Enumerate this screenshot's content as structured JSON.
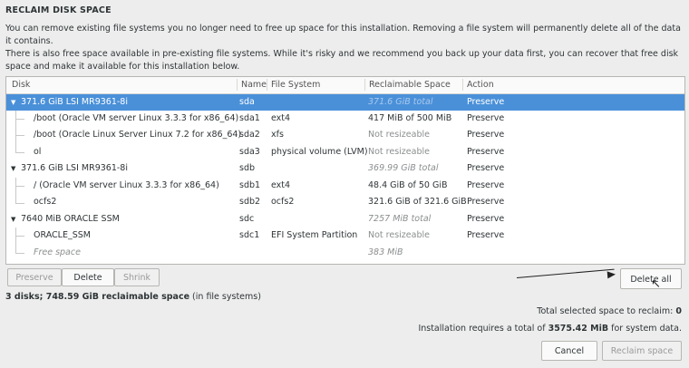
{
  "title": "RECLAIM DISK SPACE",
  "intro1": "You can remove existing file systems you no longer need to free up space for this installation.  Removing a file system will permanently delete all of the data it contains.",
  "intro2": "There is also free space available in pre-existing file systems.  While it's risky and we recommend you back up your data first, you can recover that free disk space and make it available for this installation below.",
  "columns": {
    "disk": "Disk",
    "name": "Name",
    "fs": "File System",
    "reclaim": "Reclaimable Space",
    "action": "Action"
  },
  "rows": [
    {
      "disk": "371.6 GiB LSI MR9361-8i",
      "name": "sda",
      "fs": "",
      "reclaim": "371.6 GiB total",
      "action": "Preserve"
    },
    {
      "disk": "/boot (Oracle VM server Linux 3.3.3 for x86_64)",
      "name": "sda1",
      "fs": "ext4",
      "reclaim": "417 MiB of 500 MiB",
      "action": "Preserve"
    },
    {
      "disk": "/boot (Oracle Linux Server Linux 7.2 for x86_64)",
      "name": "sda2",
      "fs": "xfs",
      "reclaim": "Not resizeable",
      "action": "Preserve"
    },
    {
      "disk": "ol",
      "name": "sda3",
      "fs": "physical volume (LVM)",
      "reclaim": "Not resizeable",
      "action": "Preserve"
    },
    {
      "disk": "371.6 GiB LSI MR9361-8i",
      "name": "sdb",
      "fs": "",
      "reclaim": "369.99 GiB total",
      "action": "Preserve"
    },
    {
      "disk": "/ (Oracle VM server Linux 3.3.3 for x86_64)",
      "name": "sdb1",
      "fs": "ext4",
      "reclaim": "48.4 GiB of 50 GiB",
      "action": "Preserve"
    },
    {
      "disk": "ocfs2",
      "name": "sdb2",
      "fs": "ocfs2",
      "reclaim": "321.6 GiB of 321.6 GiB",
      "action": "Preserve"
    },
    {
      "disk": "7640 MiB ORACLE SSM",
      "name": "sdc",
      "fs": "",
      "reclaim": "7257 MiB total",
      "action": "Preserve"
    },
    {
      "disk": "ORACLE_SSM",
      "name": "sdc1",
      "fs": "EFI System Partition",
      "reclaim": "Not resizeable",
      "action": "Preserve"
    },
    {
      "disk": "Free space",
      "name": "",
      "fs": "",
      "reclaim": "383 MiB",
      "action": ""
    }
  ],
  "buttons": {
    "preserve": "Preserve",
    "delete": "Delete",
    "shrink": "Shrink",
    "delete_all": "Delete all",
    "cancel": "Cancel",
    "reclaim": "Reclaim space"
  },
  "summary": {
    "count": "3 disks; 748.59 GiB reclaimable space",
    "suffix": " (in file systems)"
  },
  "total_selected": {
    "label": "Total selected space to reclaim: ",
    "value": "0"
  },
  "requires": {
    "prefix": "Installation requires a total of ",
    "value": "3575.42 MiB",
    "suffix": " for system data."
  }
}
